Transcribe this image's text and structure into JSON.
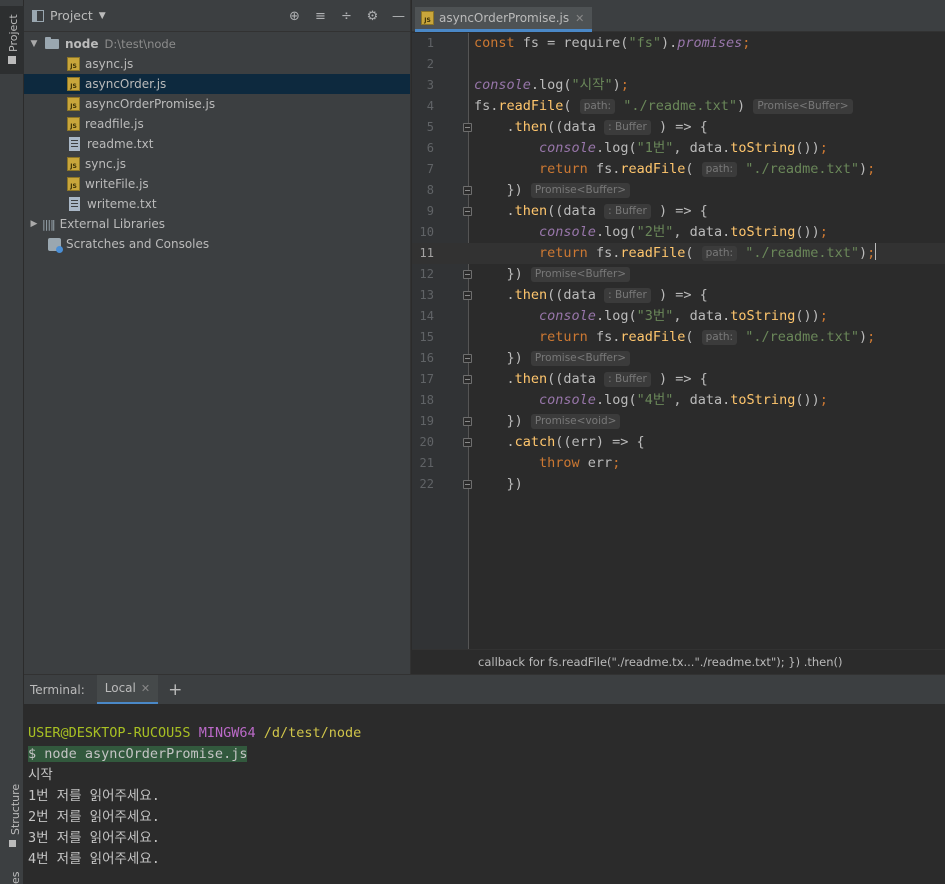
{
  "toolstrip": {
    "project": "Project",
    "structure": "Structure",
    "bottom": "es"
  },
  "project": {
    "title": "Project",
    "icons": [
      "locate-icon",
      "expand-all-icon",
      "collapse-all-icon",
      "gear-icon",
      "minimize-icon"
    ],
    "root": {
      "name": "node",
      "path": "D:\\test\\node"
    },
    "files": [
      {
        "name": "async.js",
        "type": "js"
      },
      {
        "name": "asyncOrder.js",
        "type": "js",
        "selected": true
      },
      {
        "name": "asyncOrderPromise.js",
        "type": "js"
      },
      {
        "name": "readfile.js",
        "type": "js"
      },
      {
        "name": "readme.txt",
        "type": "txt"
      },
      {
        "name": "sync.js",
        "type": "js"
      },
      {
        "name": "writeFile.js",
        "type": "js"
      },
      {
        "name": "writeme.txt",
        "type": "txt"
      }
    ],
    "external_libraries": "External Libraries",
    "scratches": "Scratches and Consoles"
  },
  "editor": {
    "tab": "asyncOrderPromise.js",
    "current_line": 11,
    "hints": {
      "path": "path:",
      "buffer": ": Buffer",
      "promise_buffer": "Promise<Buffer>",
      "promise_void": "Promise<void>"
    },
    "strings": {
      "fs": "\"fs\"",
      "start": "\"시작\"",
      "readme": "\"./readme.txt\"",
      "n1": "\"1번\"",
      "n2": "\"2번\"",
      "n3": "\"3번\"",
      "n4": "\"4번\""
    },
    "line_numbers": [
      "1",
      "2",
      "3",
      "4",
      "5",
      "6",
      "7",
      "8",
      "9",
      "10",
      "11",
      "12",
      "13",
      "14",
      "15",
      "16",
      "17",
      "18",
      "19",
      "20",
      "21",
      "22"
    ],
    "breadcrumb": "callback for fs.readFile(\"./readme.tx...\"./readme.txt\"); }) .then()"
  },
  "terminal": {
    "label": "Terminal:",
    "tab": "Local",
    "user": "USER@DESKTOP-RUCOU5S",
    "shell": "MINGW64",
    "cwd": "/d/test/node",
    "command": "$ node asyncOrderPromise.js",
    "output": [
      "시작",
      "1번 저를 읽어주세요.",
      "2번 저를 읽어주세요.",
      "3번 저를 읽어주세요.",
      "4번 저를 읽어주세요."
    ]
  }
}
